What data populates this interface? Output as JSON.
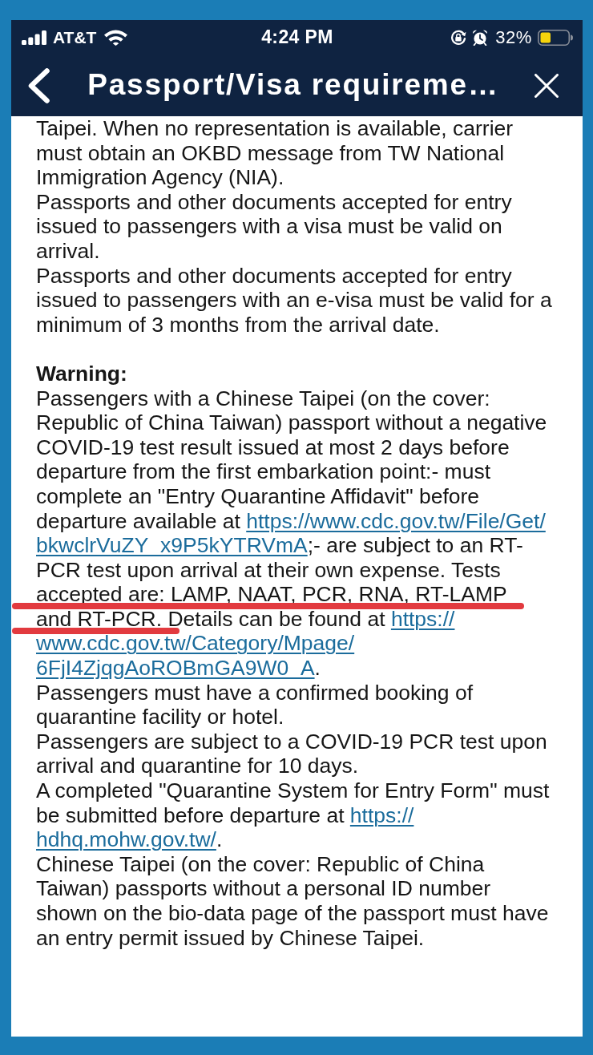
{
  "status_bar": {
    "carrier": "AT&T",
    "time": "4:24 PM",
    "battery": "32%"
  },
  "nav_bar": {
    "title": "Passport/Visa requireme…"
  },
  "content": {
    "blocks": [
      {
        "kind": "paragraph",
        "runs": [
          {
            "kind": "text",
            "text": "Taipei. When no representation is available, carrier must obtain an OKBD message from TW National Immigration Agency (NIA).",
            "marked": false
          }
        ]
      },
      {
        "kind": "paragraph",
        "runs": [
          {
            "kind": "text",
            "text": "Passports and other documents accepted for entry issued to passengers with a visa must be valid on arrival.",
            "marked": false
          }
        ]
      },
      {
        "kind": "paragraph",
        "runs": [
          {
            "kind": "text",
            "text": "Passports and other documents accepted for entry issued to passengers with an e-visa must be valid for a minimum of 3 months from the arrival date.",
            "marked": false
          }
        ]
      },
      {
        "kind": "heading",
        "text": "Warning:"
      },
      {
        "kind": "paragraph",
        "runs": [
          {
            "kind": "text",
            "text": "Passengers with a Chinese Taipei (on the cover: Republic of China Taiwan) passport without a negative COVID-19 test result issued at most 2 days before departure from the first embarkation point:- must complete an \"Entry Quarantine Affidavit\" before departure available at ",
            "marked": false
          },
          {
            "kind": "link",
            "text": "https://www.cdc.gov.tw/File/Get/",
            "marked": false
          },
          {
            "kind": "link",
            "text": "bkwclrVuZY_x9P5kYTRVmA",
            "marked": false
          },
          {
            "kind": "text",
            "text": ";- are subject to an RT-PCR test upon arrival at their own expense. Tests ",
            "marked": false
          },
          {
            "kind": "text",
            "text": "accepted are: LAMP, NAAT, PCR, RNA, RT-LAMP ",
            "marked": true
          },
          {
            "kind": "text",
            "text": "and RT-PCR.",
            "marked": true
          },
          {
            "kind": "text",
            "text": " Details can be found at ",
            "marked": false
          },
          {
            "kind": "link",
            "text": "https://",
            "marked": false
          },
          {
            "kind": "link",
            "text": "www.cdc.gov.tw/Category/Mpage/",
            "marked": false
          },
          {
            "kind": "link",
            "text": "6FjI4ZjqgAoROBmGA9W0_A",
            "marked": false
          },
          {
            "kind": "text",
            "text": ".",
            "marked": false
          }
        ]
      },
      {
        "kind": "paragraph",
        "runs": [
          {
            "kind": "text",
            "text": "Passengers must have a confirmed booking of quarantine facility or hotel.",
            "marked": false
          }
        ]
      },
      {
        "kind": "paragraph",
        "runs": [
          {
            "kind": "text",
            "text": "Passengers are subject to a COVID-19 PCR test upon arrival and quarantine for 10 days.",
            "marked": false
          }
        ]
      },
      {
        "kind": "paragraph",
        "runs": [
          {
            "kind": "text",
            "text": "A completed \"Quarantine System for Entry Form\" must be submitted before departure at ",
            "marked": false
          },
          {
            "kind": "link",
            "text": "https://",
            "marked": false
          },
          {
            "kind": "link",
            "text": "hdhq.mohw.gov.tw/",
            "marked": false
          },
          {
            "kind": "text",
            "text": ".",
            "marked": false
          }
        ]
      },
      {
        "kind": "paragraph",
        "runs": [
          {
            "kind": "text",
            "text": "Chinese Taipei (on the cover: Republic of China Taiwan) passports without a personal ID number shown on the bio-data page of the passport must have an entry permit issued by Chinese Taipei.",
            "marked": false
          }
        ]
      }
    ]
  }
}
